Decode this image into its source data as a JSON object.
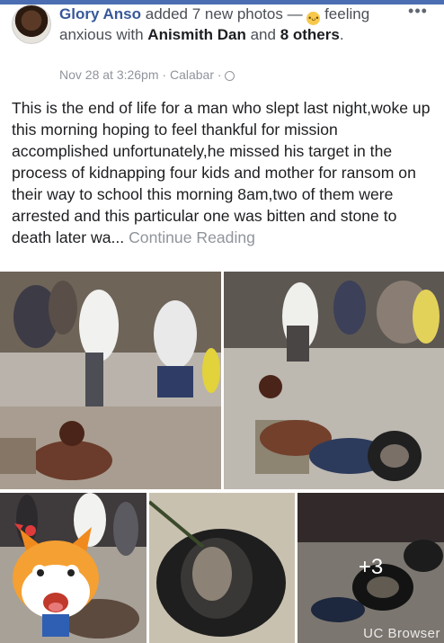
{
  "post": {
    "author": "Glory Anso",
    "action_text": "added 7 new photos —",
    "feeling_emoji": "anxious-face",
    "feeling_text": "feeling anxious with",
    "tagged": "Anismith Dan",
    "and_text": "and",
    "others": "8 others",
    "period": ".",
    "date": "Nov 28 at 3:26pm",
    "sep": "·",
    "location": "Calabar",
    "privacy_icon": "globe-icon",
    "more_label": "•••",
    "body": "This is the end of life for a man who slept last night,woke up this morning hoping to feel thankful for mission accomplished unfortunately,he missed his target in the process of kidnapping four kids and mother for ransom on their way to school this morning 8am,two of them were arrested and this particular one was  bitten and stone to death later wa...",
    "continue_label": "Continue Reading"
  },
  "photos": {
    "more_count": "+3",
    "watermark": "UC Browser"
  },
  "colors": {
    "brand_blue": "#385898",
    "topbar": "#4b6db2",
    "muted": "#90949c",
    "text": "#1c1e21"
  }
}
